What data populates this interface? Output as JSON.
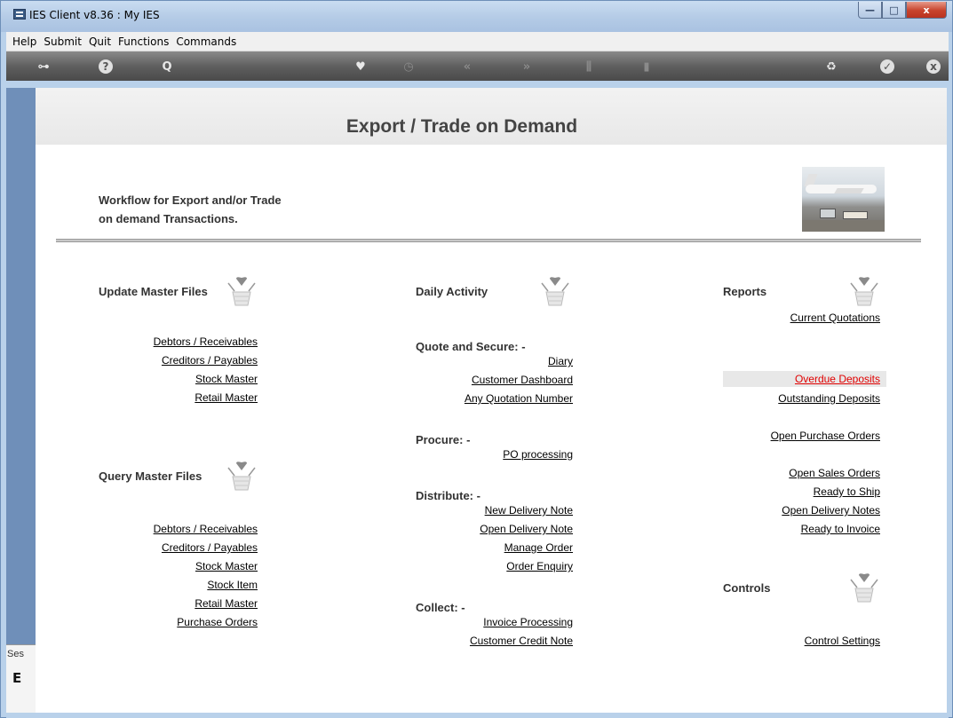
{
  "window": {
    "title": "IES Client v8.36 : My IES",
    "min_glyph": "—",
    "max_glyph": "□",
    "close_glyph": "x"
  },
  "menu": [
    "Help",
    "Submit",
    "Quit",
    "Functions",
    "Commands"
  ],
  "toolbar": {
    "icons": [
      {
        "name": "key-icon",
        "glyph": "⊶"
      },
      {
        "name": "help-icon",
        "glyph": "?"
      },
      {
        "name": "search-icon",
        "glyph": "Q"
      },
      {
        "name": "heart-icon",
        "glyph": "♥"
      },
      {
        "name": "clock-icon",
        "glyph": "◷"
      },
      {
        "name": "back-icon",
        "glyph": "«"
      },
      {
        "name": "forward-icon",
        "glyph": "»"
      },
      {
        "name": "tools-icon",
        "glyph": "⫼"
      },
      {
        "name": "page-icon",
        "glyph": "▮"
      },
      {
        "name": "recycle-icon",
        "glyph": "♻"
      },
      {
        "name": "check-icon",
        "glyph": "✓"
      },
      {
        "name": "close-icon",
        "glyph": "x"
      }
    ]
  },
  "session": {
    "label": "Ses",
    "glyph": "E"
  },
  "page": {
    "title": "Export / Trade on Demand",
    "intro_line1": "Workflow for Export and/or Trade",
    "intro_line2": "on demand Transactions."
  },
  "update_master": {
    "heading": "Update Master Files",
    "links": [
      "Debtors / Receivables",
      "Creditors / Payables",
      "Stock Master",
      "Retail Master"
    ]
  },
  "query_master": {
    "heading": "Query Master Files",
    "links": [
      "Debtors / Receivables",
      "Creditors / Payables",
      "Stock Master",
      "Stock Item",
      "Retail Master",
      "Purchase Orders"
    ]
  },
  "daily": {
    "heading": "Daily Activity",
    "quote_heading": "Quote and Secure: -",
    "quote_links": [
      "Diary",
      "Customer Dashboard",
      "Any Quotation Number"
    ],
    "procure_heading": "Procure: -",
    "procure_links": [
      "PO processing"
    ],
    "distribute_heading": "Distribute: -",
    "distribute_links": [
      "New Delivery Note",
      "Open Delivery Note",
      "Manage Order",
      "Order Enquiry"
    ],
    "collect_heading": "Collect: -",
    "collect_links": [
      "Invoice Processing",
      "Customer Credit Note"
    ]
  },
  "reports": {
    "heading": "Reports",
    "links": [
      "Current Quotations",
      "Overdue Deposits",
      "Outstanding Deposits",
      "Open Purchase Orders",
      "Open Sales Orders",
      "Ready to Ship",
      "Open Delivery Notes",
      "Ready to Invoice"
    ],
    "highlighted": "Overdue Deposits",
    "highlight_color": "#e00000"
  },
  "controls": {
    "heading": "Controls",
    "links": [
      "Control Settings"
    ]
  }
}
